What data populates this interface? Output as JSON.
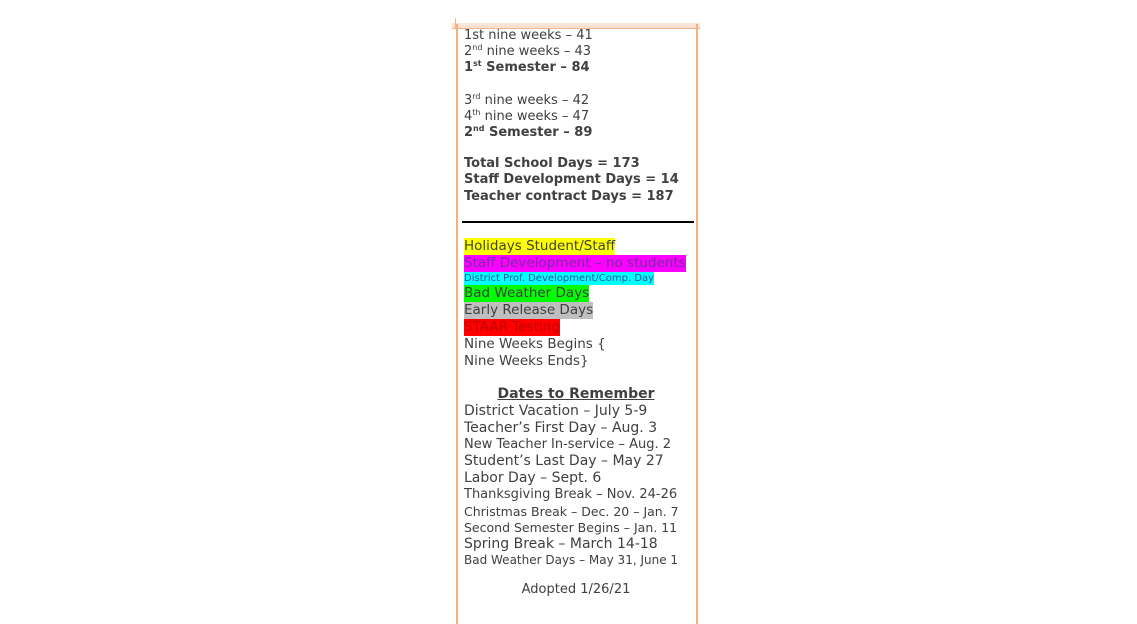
{
  "summary": {
    "q1": {
      "num": "1",
      "sup": "st",
      "text": " nine weeks – 41"
    },
    "q2": {
      "num": "2",
      "sup": "nd",
      "text": " nine weeks – 43"
    },
    "sem1": {
      "num": "1",
      "sup": "st",
      "text": " Semester – 84"
    },
    "q3": {
      "num": "3",
      "sup": "rd",
      "text": " nine weeks – 42"
    },
    "q4": {
      "num": "4",
      "sup": "th",
      "text": " nine weeks – 47"
    },
    "sem2": {
      "num": "2",
      "sup": "nd",
      "text": " Semester – 89"
    },
    "total_school_days": "Total School Days = 173",
    "staff_dev_days": "Staff Development Days = 14",
    "teacher_contract_days": "Teacher contract Days = 187"
  },
  "legend": [
    {
      "label": "Holidays Student/Staff",
      "color": "#ffff00",
      "text_color": "#404040"
    },
    {
      "label": "Staff Development – no students",
      "color": "#ff00ff",
      "text_color": "#7030a0"
    },
    {
      "label": "District Prof. Development/Comp. Day",
      "color": "#00ffff",
      "text_color": "#2f5496"
    },
    {
      "label": "Bad Weather Days",
      "color": "#00ff00",
      "text_color": "#404040"
    },
    {
      "label": "Early Release Days",
      "color": "#bfbfbf",
      "text_color": "#404040"
    },
    {
      "label": "STAAR Testing",
      "color": "#ff0000",
      "text_color": "#c00000"
    },
    {
      "label": "Nine Weeks Begins {"
    },
    {
      "label": "Nine Weeks Ends}"
    }
  ],
  "dates": {
    "title": "Dates to Remember",
    "items": [
      "District Vacation – July 5-9",
      "Teacher’s First Day – Aug. 3",
      "New Teacher In-service – Aug. 2",
      "Student’s Last Day – May 27",
      "Labor Day – Sept. 6",
      "Thanksgiving Break – Nov. 24-26",
      "Christmas Break – Dec. 20 – Jan. 7",
      "Second Semester Begins – Jan. 11",
      "Spring Break – March 14-18",
      "Bad Weather Days – May 31, June 1"
    ]
  },
  "adopted": "Adopted 1/26/21"
}
